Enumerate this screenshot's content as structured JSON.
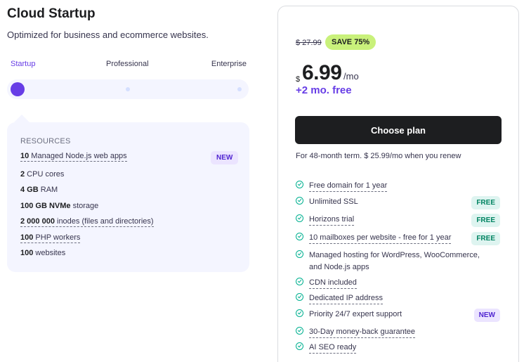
{
  "plan": {
    "title": "Cloud Startup",
    "subtitle": "Optimized for business and ecommerce websites."
  },
  "tiers": {
    "labels": [
      "Startup",
      "Professional",
      "Enterprise"
    ],
    "selected": "Startup"
  },
  "resources": {
    "heading": "RESOURCES",
    "items": [
      {
        "bold": "10",
        "text": " Managed Node.js web apps"
      },
      {
        "bold": "2",
        "text": " CPU cores"
      },
      {
        "bold": "4 GB",
        "text": " RAM"
      },
      {
        "bold": "100 GB NVMe",
        "text": " storage"
      },
      {
        "bold": "2 000 000",
        "text": " inodes (files and directories)"
      },
      {
        "bold": "100",
        "text": " PHP workers"
      },
      {
        "bold": "100",
        "text": " websites"
      }
    ],
    "new_badge": "NEW"
  },
  "pricing": {
    "old_price": "$ 27.99",
    "save_badge": "SAVE 75%",
    "currency": "$",
    "price": "6.99",
    "per": "/mo",
    "free_months": "+2 mo. free",
    "cta": "Choose plan",
    "renew_note": "For 48-month term. $ 25.99/mo when you renew"
  },
  "features": [
    {
      "text": "Free domain for 1 year",
      "badge": ""
    },
    {
      "text": "Unlimited SSL",
      "badge": "FREE"
    },
    {
      "text": "Horizons trial",
      "badge": "FREE"
    },
    {
      "text": "10 mailboxes per website - free for 1 year",
      "badge": "FREE"
    },
    {
      "text": "Managed hosting for WordPress, WooCommerce,",
      "text2": "and Node.js apps",
      "badge": ""
    },
    {
      "text": "CDN included",
      "badge": ""
    },
    {
      "text": "Dedicated IP address",
      "badge": ""
    },
    {
      "text": "Priority 24/7 expert support",
      "badge": "NEW"
    },
    {
      "text": "30-Day money-back guarantee",
      "badge": ""
    },
    {
      "text": "AI SEO ready",
      "badge": ""
    }
  ],
  "colors": {
    "accent": "#673de6",
    "check": "#00b090",
    "save_badge": "#c9f17b",
    "cta_bg": "#1d1e20"
  }
}
